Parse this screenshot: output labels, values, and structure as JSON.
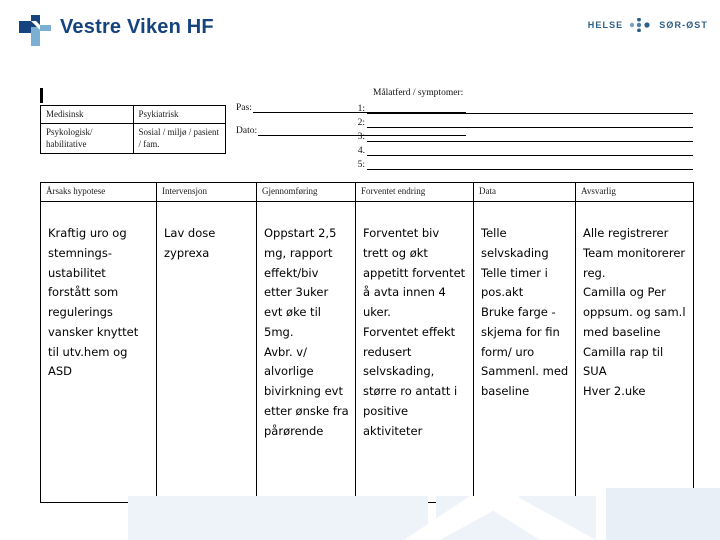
{
  "header": {
    "brand": "Vestre Viken HF",
    "logo_icon": "cross-logo-icon",
    "partner_logo": {
      "left_text": "HELSE",
      "right_text": "SØR-ØST",
      "dots_icon": "three-dots-icon"
    }
  },
  "colors": {
    "brand_dark_blue": "#14437e",
    "brand_light_blue": "#7bafd4",
    "partner_blue": "#2d5f86",
    "deco_blue": "#eef3f9",
    "rule_black": "#000000"
  },
  "form": {
    "domain_table": {
      "rows": [
        [
          "Medisinsk",
          "Psykiatrisk"
        ],
        [
          "Psykologisk/ habilitative",
          "Sosial / miljø / pasient / fam."
        ]
      ]
    },
    "identification": [
      {
        "label": "Pas:",
        "value": ""
      },
      {
        "label": "Dato:",
        "value": ""
      }
    ],
    "goal_section": {
      "title": "Målatferd / symptomer:",
      "lines": [
        {
          "num": "1:",
          "value": ""
        },
        {
          "num": "2:",
          "value": ""
        },
        {
          "num": "3:",
          "value": ""
        },
        {
          "num": "4.",
          "value": ""
        },
        {
          "num": "5:",
          "value": ""
        }
      ]
    }
  },
  "plan_table": {
    "headers": [
      "Årsaks hypotese",
      "Intervensjon",
      "Gjennomføring",
      "Forventet endring",
      "Data",
      "Avsvarlig"
    ],
    "row": {
      "arsaks_hypotese": "Kraftig uro og stemnings-ustabilitet forstått som regulerings vansker knyttet til utv.hem og ASD",
      "intervensjon": "Lav dose zyprexa",
      "gjennomforing_1": "Oppstart 2,5 mg, rapport effekt/biv etter 3uker evt øke til 5mg.",
      "gjennomforing_2": "Avbr. v/ alvorlige bivirkning evt etter ønske fra pårørende",
      "forventet_endring_1": "Forventet biv trett og økt appetitt forventet å avta innen 4 uker.",
      "forventet_endring_2": "Forventet effekt redusert selvskading, større ro antatt i positive aktiviteter",
      "data_1": "Telle selvskading",
      "data_2": "Telle timer i pos.akt",
      "data_3": "Bruke farge -skjema for fin form/ uro",
      "data_4": "Sammenl. med baseline",
      "avsvarlig_1": "Alle registrerer",
      "avsvarlig_2": "Team monitorerer reg.",
      "avsvarlig_3": "Camilla og Per oppsum. og sam.l med baseline",
      "avsvarlig_4": "Camilla rap til SUA",
      "avsvarlig_5": "Hver 2.uke"
    }
  }
}
